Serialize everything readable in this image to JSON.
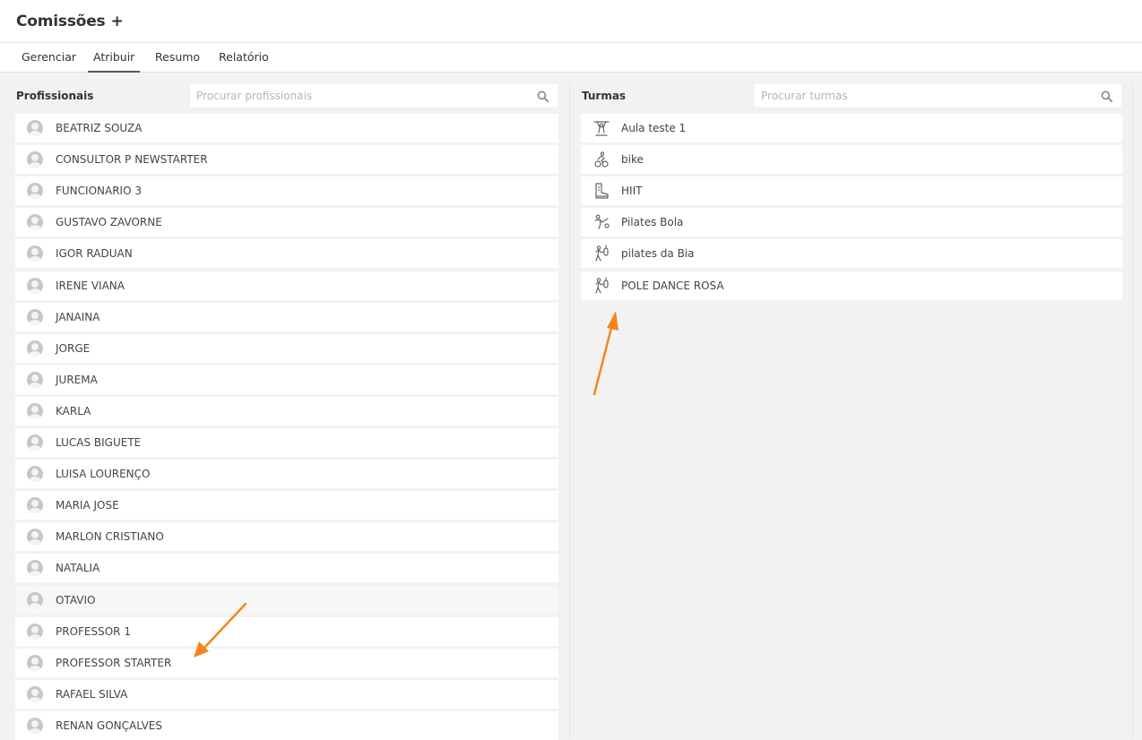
{
  "header": {
    "title": "Comissões",
    "add_symbol": "+"
  },
  "tabs": [
    {
      "label": "Gerenciar"
    },
    {
      "label": "Atribuir"
    },
    {
      "label": "Resumo"
    },
    {
      "label": "Relatório"
    }
  ],
  "active_tab": "Atribuir",
  "professionals": {
    "label": "Profissionais",
    "search_placeholder": "Procurar profissionais",
    "items": [
      "BEATRIZ SOUZA",
      "CONSULTOR P NEWSTARTER",
      "FUNCIONARIO 3",
      "GUSTAVO ZAVORNE",
      "IGOR RADUAN",
      "IRENE VIANA",
      "JANAINA",
      "JORGE",
      "JUREMA",
      "KARLA",
      "LUCAS BIGUETE",
      "LUISA LOURENÇO",
      "MARIA JOSE",
      "MARLON CRISTIANO",
      "NATALIA",
      "OTAVIO",
      "PROFESSOR 1",
      "PROFESSOR STARTER",
      "RAFAEL SILVA",
      "RENAN GONÇALVES"
    ]
  },
  "classes": {
    "label": "Turmas",
    "search_placeholder": "Procurar turmas",
    "items": [
      {
        "name": "Aula teste 1",
        "icon": "gymnastics-icon"
      },
      {
        "name": "bike",
        "icon": "cycling-icon"
      },
      {
        "name": "HIIT",
        "icon": "boot-icon"
      },
      {
        "name": "Pilates Bola",
        "icon": "kick-icon"
      },
      {
        "name": "pilates da Bia",
        "icon": "boxing-icon"
      },
      {
        "name": "POLE DANCE ROSA",
        "icon": "boxing-icon"
      }
    ]
  },
  "colors": {
    "accent_arrow": "#f5841f",
    "tab_underline": "#4a5a6a",
    "avatar": "#c7c7c7"
  }
}
